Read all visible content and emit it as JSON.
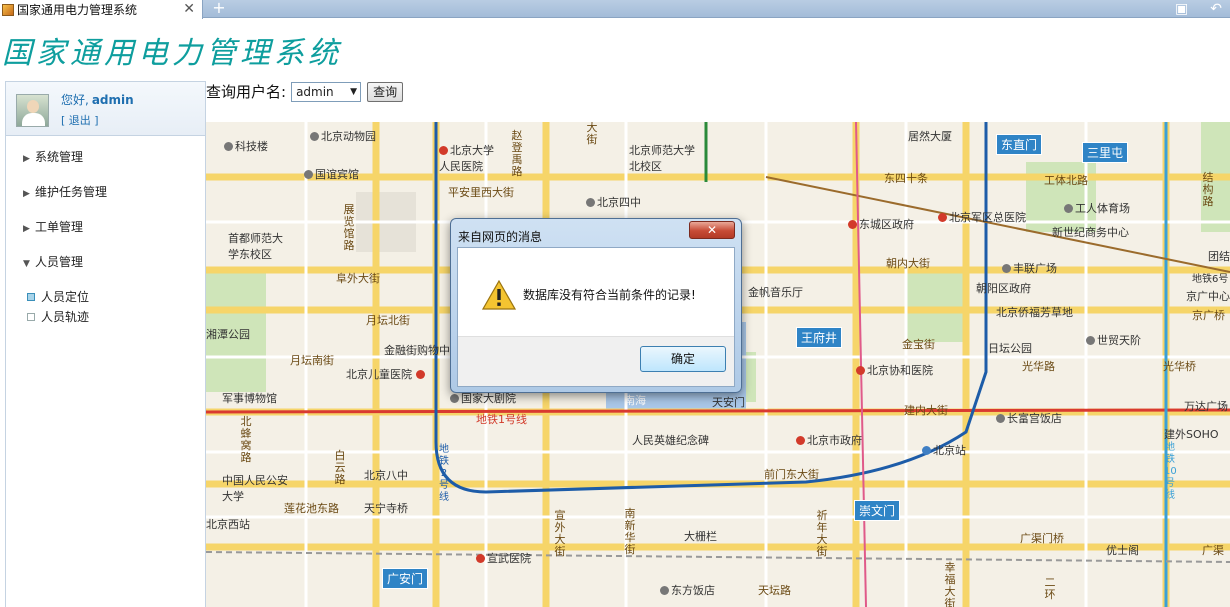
{
  "browser": {
    "tab_title": "国家通用电力管理系统",
    "tab_close": "✕",
    "new_tab": "+",
    "icons": [
      "favicon-icon",
      "close-icon",
      "new-tab-icon",
      "window-icon",
      "back-arrow-icon"
    ]
  },
  "app": {
    "logo_text": "国家通用电力管理系统"
  },
  "user": {
    "greeting": "您好,",
    "username": "admin",
    "logout": "[ 退出 ]"
  },
  "menu": {
    "items": [
      {
        "label": "系统管理",
        "expanded": false
      },
      {
        "label": "维护任务管理",
        "expanded": false
      },
      {
        "label": "工单管理",
        "expanded": false
      },
      {
        "label": "人员管理",
        "expanded": true
      }
    ],
    "sub_items": [
      {
        "label": "人员定位",
        "active": true
      },
      {
        "label": "人员轨迹",
        "active": false
      }
    ]
  },
  "query": {
    "label": "查询用户名:",
    "selected_user": "admin",
    "button": "查询"
  },
  "dialog": {
    "title": "来自网页的消息",
    "close": "✕",
    "message": "数据库没有符合当前条件的记录!",
    "ok_button": "确定"
  },
  "map": {
    "labels": {
      "l01": "北京动物园",
      "l02": "科技楼",
      "l03": "北京大学人民医院",
      "l04": "赵登禹路",
      "l05": "大街",
      "l06": "北京师范大学北校区",
      "l07": "居然大厦",
      "l08": "东直门",
      "l09": "三里屯",
      "l10": "国谊宾馆",
      "l11": "平安里西大街",
      "l12": "北京四中",
      "l13": "东四十条",
      "l14": "工体北路",
      "l15": "工人体育场",
      "l16": "结构路",
      "l17": "首都师范大学东校区",
      "l18": "展览馆路",
      "l19": "东城区政府",
      "l20": "北京军区总医院",
      "l21": "新世纪商务中心",
      "l22": "团结湖",
      "l23": "阜外大街",
      "l24": "朝内大街",
      "l25": "丰联广场",
      "l26": "地铁6号",
      "l27": "朝阳区政府",
      "l28": "京广中心商",
      "l29": "金帆音乐厅",
      "l30": "北京侨福芳草地",
      "l31": "京广桥",
      "l32": "月坛北街",
      "l33": "湘潭公园",
      "l34": "王府井",
      "l35": "世贸天阶",
      "l36": "金融街购物中",
      "l37": "金宝街",
      "l38": "日坛公园",
      "l39": "光华路",
      "l40": "光华桥",
      "l41": "月坛南街",
      "l42": "北京儿童医院",
      "l43": "北京协和医院",
      "l44": "军事博物馆",
      "l45": "国家大剧院",
      "l46": "南海",
      "l47": "天安门",
      "l48": "万达广场",
      "l49": "地铁1号线",
      "l50": "建内大街",
      "l51": "长富宫饭店",
      "l52": "北蜂窝路",
      "l53": "人民英雄纪念碑",
      "l54": "北京市政府",
      "l55": "建外SOHO",
      "l56": "白云路",
      "l57": "北京站",
      "l58": "地铁2号线",
      "l59": "中国人民公安大学",
      "l60": "北京八中",
      "l61": "前门东大街",
      "l62": "地铁10号线",
      "l63": "莲花池东路",
      "l64": "天宁寺桥",
      "l65": "崇文门",
      "l66": "北京西站",
      "l67": "宣外大街",
      "l68": "南新华街",
      "l69": "大栅栏",
      "l70": "祈年大街",
      "l71": "广渠门桥",
      "l72": "优士阁",
      "l73": "广渠",
      "l74": "宣武医院",
      "l75": "广安门",
      "l76": "东方饭店",
      "l77": "天坛路",
      "l78": "幸福大街",
      "l79": "二环"
    }
  }
}
